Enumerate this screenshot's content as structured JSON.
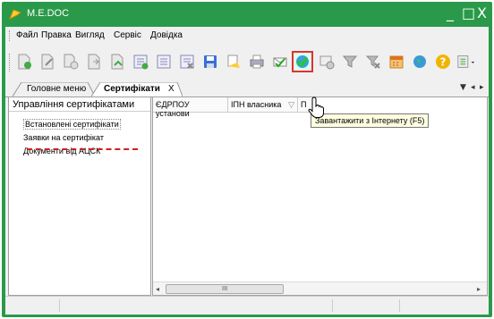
{
  "window": {
    "title": "M.E.DOC",
    "controls": {
      "minimize": "_",
      "maximize": "□",
      "close": "X"
    }
  },
  "menu": {
    "items": [
      "Файл",
      "Правка",
      "Вигляд",
      "Сервіс",
      "Довідка"
    ]
  },
  "toolbar": {
    "buttons": [
      "new-document-icon",
      "edit-document-icon",
      "copy-document-icon",
      "move-document-icon",
      "export-document-icon",
      "add-list-icon",
      "list-icon",
      "delete-list-icon",
      "save-icon",
      "print-preview-icon",
      "print-icon",
      "envelope-check-icon",
      "download-internet-icon",
      "certificate-icon",
      "filter-icon",
      "clear-filter-icon",
      "calendar-icon",
      "globe-icon",
      "help-icon",
      "export-menu-icon"
    ],
    "tooltip": "Завантажити з Інтернету (F5)"
  },
  "tabs": {
    "items": [
      {
        "label": "Головне меню",
        "active": false
      },
      {
        "label": "Сертифікати",
        "active": true,
        "close": "X"
      }
    ]
  },
  "left_panel": {
    "header": "Управління сертифікатами",
    "items": [
      "Встановлені сертифікати",
      "Заявки на сертифікат",
      "Документи від АЦСК"
    ],
    "selected_index": 0
  },
  "grid": {
    "columns": [
      "ЄДРПОУ установи",
      "ІПН власника",
      "П"
    ]
  },
  "colors": {
    "titlebar": "#2a9a4a",
    "highlight_border": "#dd3333",
    "tooltip_bg": "#ffffe1"
  }
}
